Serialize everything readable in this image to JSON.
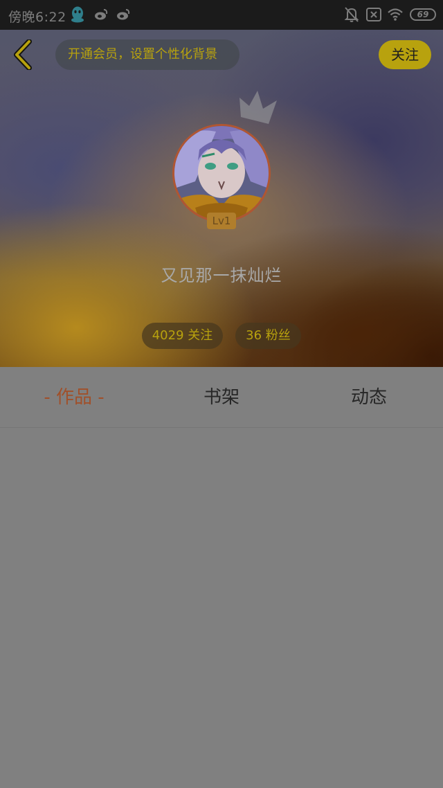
{
  "status_bar": {
    "time": "傍晚6:22",
    "battery": "69",
    "icons": [
      "qq-icon",
      "weibo-icon",
      "weibo-icon",
      "mute-bell-icon",
      "no-sim-icon",
      "wifi-icon",
      "battery-icon"
    ]
  },
  "header": {
    "back_icon": "chevron-left-icon",
    "vip_banner": "开通会员，设置个性化背景",
    "follow_label": "关注"
  },
  "profile": {
    "username": "又见那一抹灿烂",
    "level": "Lv1",
    "following": "4029 关注",
    "fans": "36 粉丝"
  },
  "tabs": [
    {
      "label": "- 作品 -",
      "active": true
    },
    {
      "label": "书架",
      "active": false
    },
    {
      "label": "动态",
      "active": false
    }
  ],
  "colors": {
    "accent_yellow": "#b8a20e",
    "active_tab": "#a0502a",
    "overlay_gray": "#808080"
  }
}
